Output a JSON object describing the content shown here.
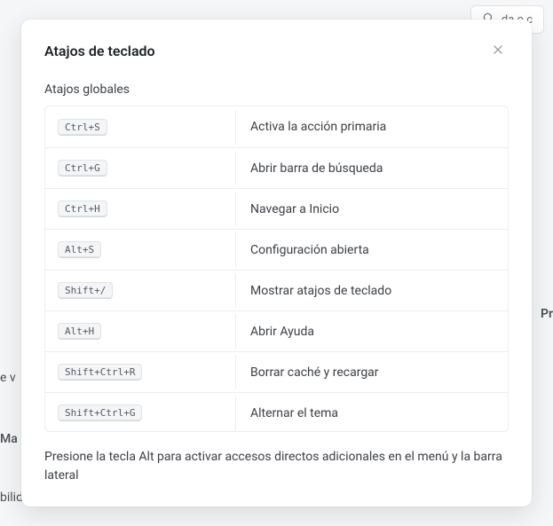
{
  "background": {
    "search_placeholder": "da o c",
    "left_hints": [
      "e v",
      "Ma",
      "bilid"
    ],
    "right_hint": "Pr"
  },
  "modal": {
    "title": "Atajos de teclado",
    "section_title": "Atajos globales",
    "shortcuts": [
      {
        "key": "Ctrl+S",
        "desc": "Activa la acción primaria"
      },
      {
        "key": "Ctrl+G",
        "desc": "Abrir barra de búsqueda"
      },
      {
        "key": "Ctrl+H",
        "desc": "Navegar a Inicio"
      },
      {
        "key": "Alt+S",
        "desc": "Configuración abierta"
      },
      {
        "key": "Shift+/",
        "desc": "Mostrar atajos de teclado"
      },
      {
        "key": "Alt+H",
        "desc": "Abrir Ayuda"
      },
      {
        "key": "Shift+Ctrl+R",
        "desc": "Borrar caché y recargar"
      },
      {
        "key": "Shift+Ctrl+G",
        "desc": "Alternar el tema"
      }
    ],
    "footnote": "Presione la tecla Alt para activar accesos directos adicionales en el menú y la barra lateral"
  }
}
